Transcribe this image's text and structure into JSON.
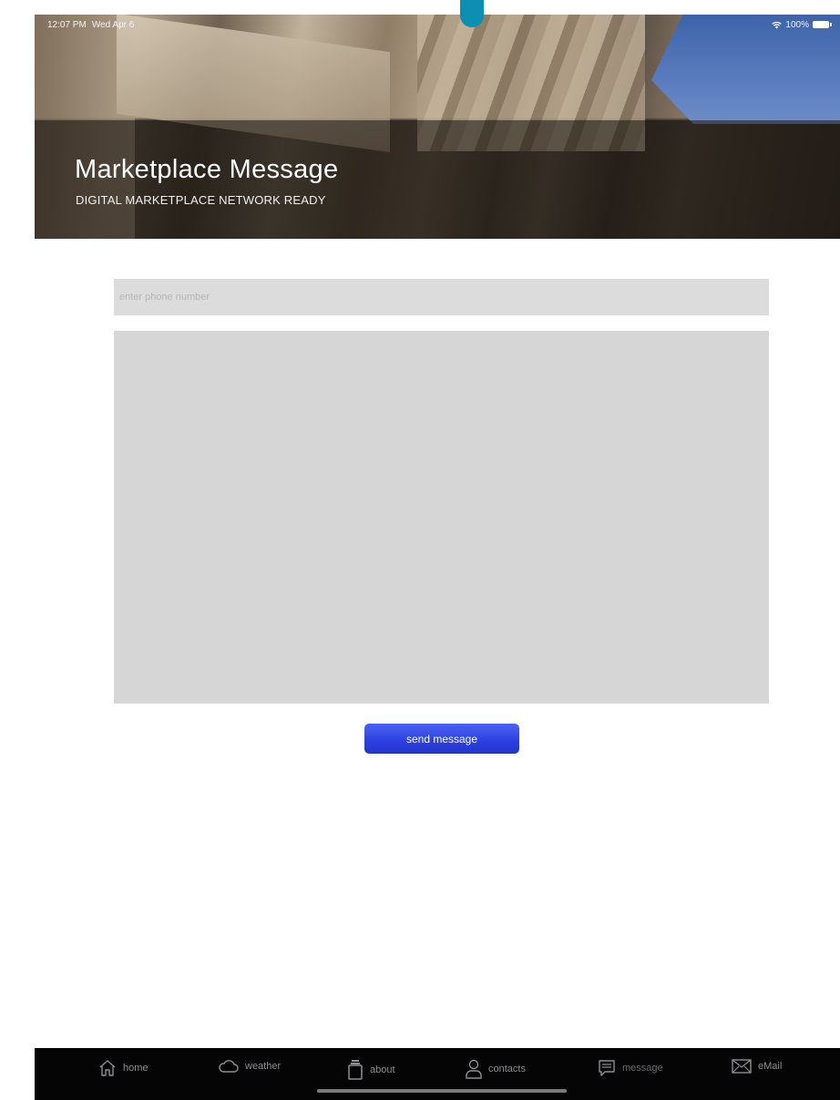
{
  "status_bar": {
    "time": "12:07 PM",
    "date": "Wed Apr 6",
    "battery": "100%"
  },
  "header": {
    "title": "Marketplace Message",
    "subtitle": "DIGITAL MARKETPLACE NETWORK READY"
  },
  "form": {
    "phone_placeholder": "enter phone number",
    "phone_value": "",
    "message_value": "",
    "send_label": "send message"
  },
  "tab_bar": {
    "items": [
      {
        "label": "home",
        "icon": "home-icon"
      },
      {
        "label": "weather",
        "icon": "cloud-icon"
      },
      {
        "label": "about",
        "icon": "jar-icon"
      },
      {
        "label": "contacts",
        "icon": "person-icon"
      },
      {
        "label": "message",
        "icon": "message-icon"
      },
      {
        "label": "eMail",
        "icon": "envelope-icon"
      }
    ]
  },
  "colors": {
    "accent": "#2c3fe0",
    "camera_dot": "#0d8fb4",
    "input_bg": "#dcdcdc",
    "tab_bar_bg": "#050505"
  }
}
